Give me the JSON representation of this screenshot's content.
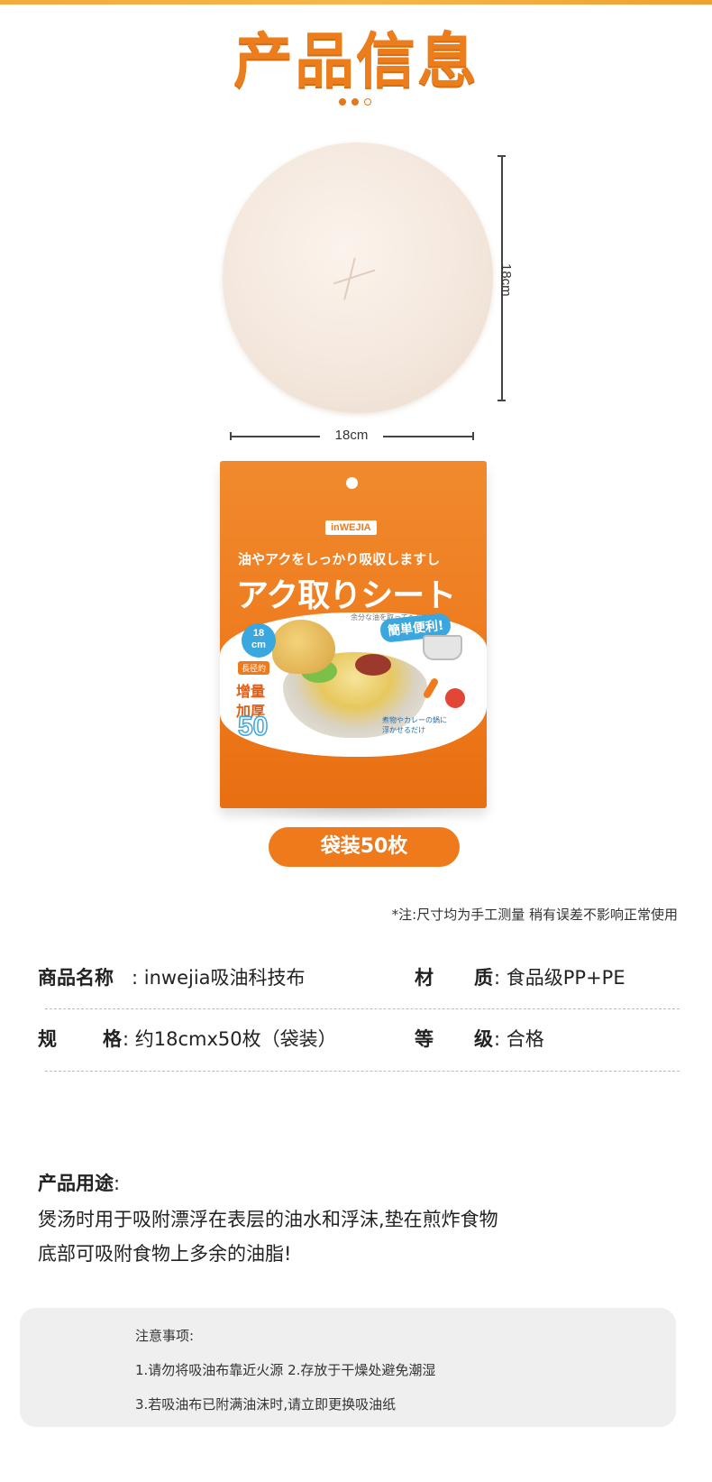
{
  "header": {
    "title": "产品信息"
  },
  "dimensions": {
    "height_label": "18cm",
    "width_label": "18cm"
  },
  "package": {
    "brand": "inWEJIA",
    "subtitle": "油やアクをしっかり吸収しますし",
    "main_title": "アク取りシート",
    "tagline": "余分な油を取ってヘルシーに",
    "size_badge_line1": "18",
    "size_badge_line2": "cm",
    "diameter_label": "長径約",
    "convenient_label": "簡単便利!",
    "thick_line1": "增量",
    "thick_line2": "加厚",
    "count": "50",
    "count_unit": "枚入",
    "note_line1": "煮物やカレーの鍋に",
    "note_line2": "浮かせるだけ"
  },
  "pack_label": "袋装50枚",
  "measurement_note": "*注:尺寸均为手工测量 稍有误差不影响正常使用",
  "specs": {
    "name_label": "商品名称",
    "name_value": ": inwejia吸油科技布",
    "material_label_a": "材",
    "material_label_b": "质",
    "material_value": ": 食品级PP+PE",
    "spec_label_a": "规",
    "spec_label_b": "格",
    "spec_value": ": 约18cmx50枚（袋装）",
    "grade_label_a": "等",
    "grade_label_b": "级",
    "grade_value": ": 合格"
  },
  "usage": {
    "title": "产品用途",
    "colon": ":",
    "line1": "煲汤时用于吸附漂浮在表层的油水和浮沫,垫在煎炸食物",
    "line2": "底部可吸附食物上多余的油脂!"
  },
  "caution": {
    "title": "注意事项:",
    "line1": "1.请勿将吸油布靠近火源   2.存放于干燥处避免潮湿",
    "line2": "3.若吸油布已附满油沫时,请立即更换吸油纸"
  },
  "colors": {
    "accent": "#ee7a1c",
    "top_bar": "#f4a93b",
    "caution_bg": "#efefef"
  }
}
